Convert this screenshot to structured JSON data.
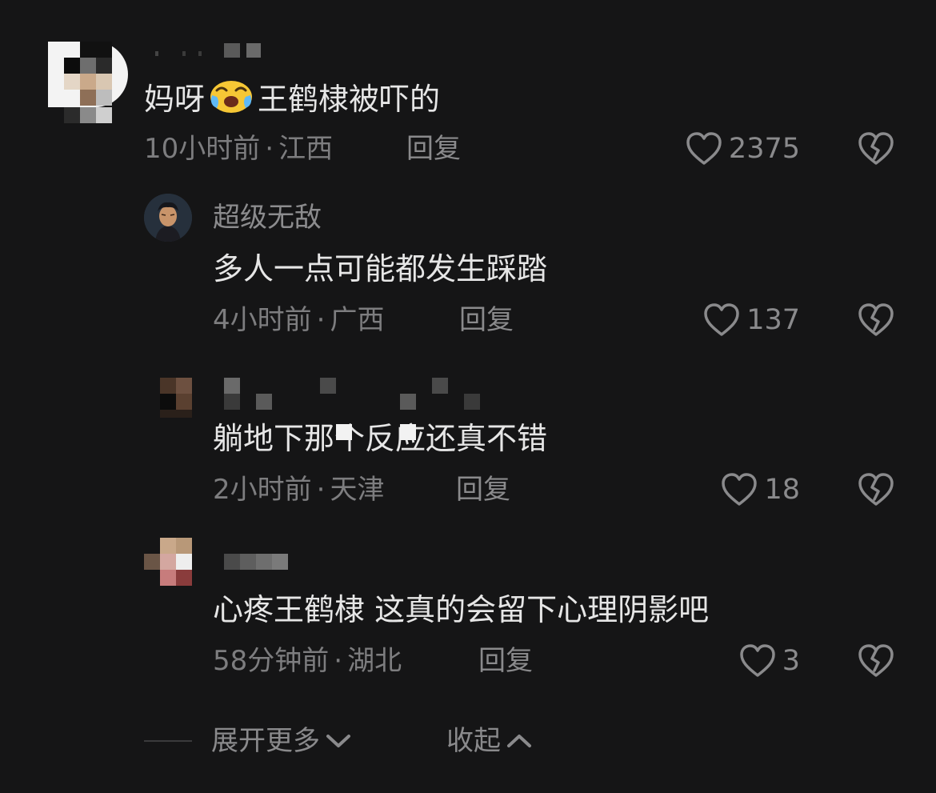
{
  "comments": [
    {
      "text_before": "妈呀",
      "emoji": "laughing-crying-emoji",
      "text_after": "王鹤棣被吓的",
      "time": "10小时前",
      "location": "江西",
      "reply_label": "回复",
      "likes": "2375"
    },
    {
      "username": "超级无敌",
      "text": "多人一点可能都发生踩踏",
      "time": "4小时前",
      "location": "广西",
      "reply_label": "回复",
      "likes": "137"
    },
    {
      "text": "躺地下那个反应还真不错",
      "time": "2小时前",
      "location": "天津",
      "reply_label": "回复",
      "likes": "18"
    },
    {
      "text": "心疼王鹤棣 这真的会留下心理阴影吧",
      "time": "58分钟前",
      "location": "湖北",
      "reply_label": "回复",
      "likes": "3"
    }
  ],
  "separator": "·",
  "footer": {
    "expand_label": "展开更多",
    "collapse_label": "收起"
  },
  "colors": {
    "background": "#151516",
    "primary_text": "#e6e6e6",
    "secondary_text": "#7d7d7f",
    "icon": "#8a8a8c"
  },
  "icons": {
    "like": "heart-outline-icon",
    "dislike": "broken-heart-icon",
    "expand": "chevron-down-icon",
    "collapse": "chevron-up-icon"
  }
}
